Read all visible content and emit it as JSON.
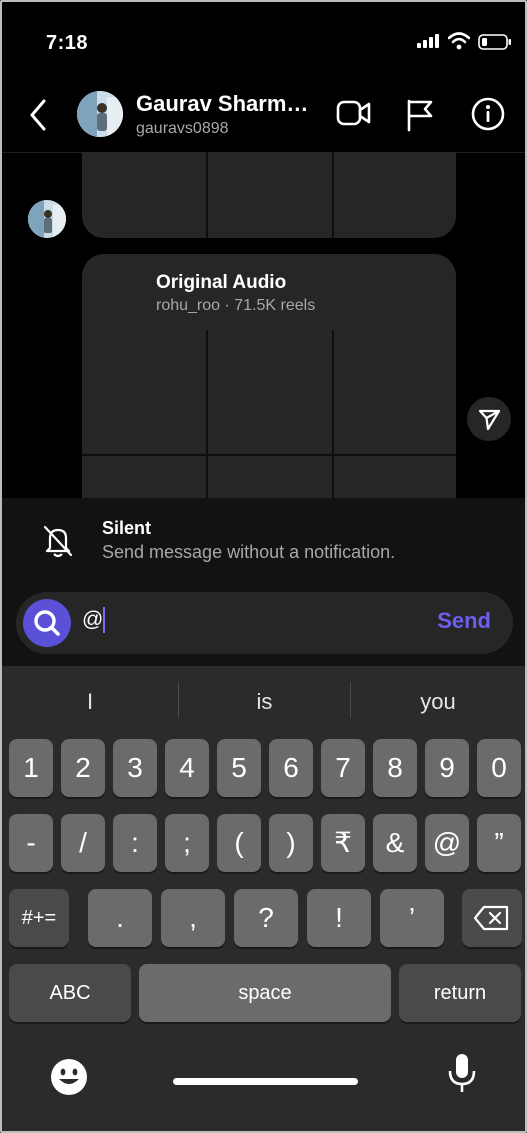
{
  "status_bar": {
    "time": "7:18"
  },
  "header": {
    "name": "Gaurav Sharm…",
    "username": "gauravs0898",
    "icons": [
      "back-chevron-icon",
      "video-call-icon",
      "report-flag-icon",
      "info-icon"
    ]
  },
  "reel": {
    "title": "Original Audio",
    "subtitle": "rohu_roo · 71.5K reels"
  },
  "silent": {
    "title": "Silent",
    "description": "Send message without a notification."
  },
  "composer": {
    "text": "@",
    "send_label": "Send"
  },
  "keyboard": {
    "suggestions": [
      "I",
      "is",
      "you"
    ],
    "row1": [
      "1",
      "2",
      "3",
      "4",
      "5",
      "6",
      "7",
      "8",
      "9",
      "0"
    ],
    "row2": [
      "-",
      "/",
      ":",
      ";",
      "(",
      ")",
      "₹",
      "&",
      "@",
      "”"
    ],
    "row3": [
      "#+=",
      ".",
      ",",
      "?",
      "!",
      "’"
    ],
    "abc_label": "ABC",
    "space_label": "space",
    "return_label": "return"
  }
}
